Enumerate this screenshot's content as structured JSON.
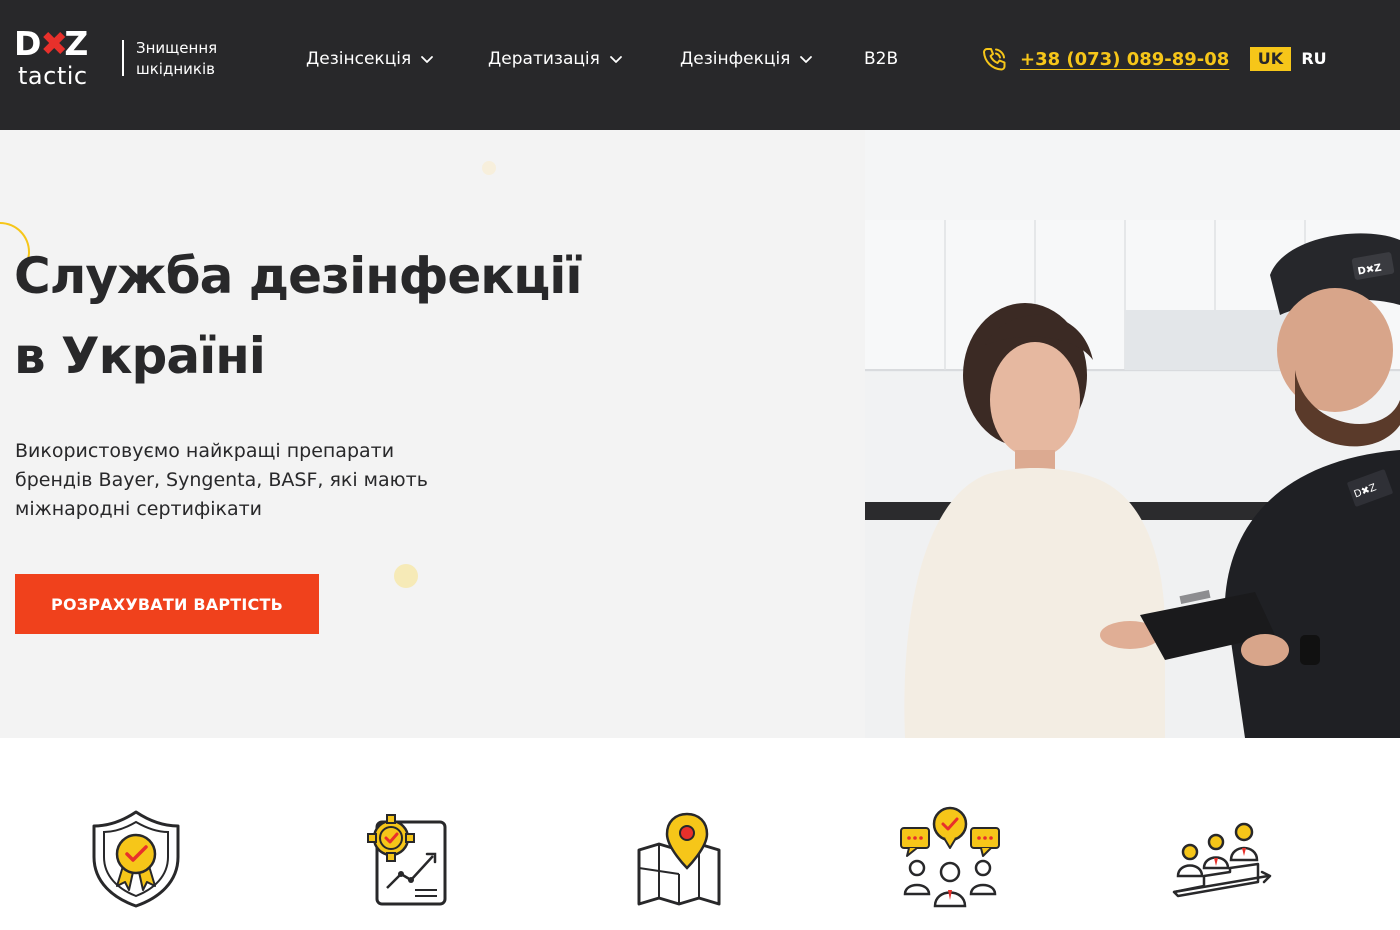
{
  "header": {
    "logo": {
      "top": "D✖Z",
      "bottom": "tactic"
    },
    "tagline": [
      "Знищення",
      "шкідників"
    ],
    "nav": [
      {
        "label": "Дезінсекція",
        "dropdown": true
      },
      {
        "label": "Дератизація",
        "dropdown": true
      },
      {
        "label": "Дезінфекція",
        "dropdown": true
      },
      {
        "label": "B2B",
        "dropdown": false
      }
    ],
    "phone": "+38 (073) 089-89-08",
    "languages": [
      {
        "code": "UK",
        "active": true
      },
      {
        "code": "RU",
        "active": false
      }
    ]
  },
  "hero": {
    "title_line1": "Служба дезінфекції",
    "title_line2": "в Україні",
    "subtitle_line1": "Використовуємо найкращі препарати",
    "subtitle_line2": "брендів Bayer, Syngenta, BASF, які мають",
    "subtitle_line3": "міжнародні сертифікати",
    "cta_label": "РОЗРАХУВАТИ ВАРТІСТЬ",
    "photo_cap_logo": "D✖Z tactic"
  },
  "features": [
    {
      "icon": "shield-certificate-icon"
    },
    {
      "icon": "gear-growth-chart-icon"
    },
    {
      "icon": "map-location-pin-icon"
    },
    {
      "icon": "team-approval-chat-icon"
    },
    {
      "icon": "team-podium-progress-icon"
    }
  ],
  "colors": {
    "header_bg": "#28282a",
    "accent_yellow": "#f6c619",
    "cta_red": "#f0411c",
    "logo_red": "#e8302b",
    "hero_bg": "#f3f3f3"
  }
}
